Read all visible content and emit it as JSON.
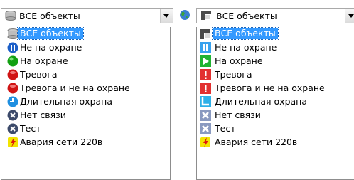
{
  "left_combo": {
    "value": "ВСЕ объекты",
    "icon": "database-icon"
  },
  "right_combo": {
    "value": "ВСЕ объекты",
    "icon": "folder-dark-icon"
  },
  "globe_icon": "globe-icon",
  "left_list": [
    {
      "label": "ВСЕ объекты",
      "icon": "database-icon",
      "selected": true
    },
    {
      "label": "Не на охране",
      "icon": "pause-circle-blue-icon"
    },
    {
      "label": "На охране",
      "icon": "circle-green-icon"
    },
    {
      "label": "Тревога",
      "icon": "circle-red-icon"
    },
    {
      "label": "Тревога и не на охране",
      "icon": "circle-red-icon"
    },
    {
      "label": "Длительная охрана",
      "icon": "clock-blue-icon"
    },
    {
      "label": "Нет связи",
      "icon": "x-circle-gray-icon"
    },
    {
      "label": "Тест",
      "icon": "x-circle-gray-icon"
    },
    {
      "label": "Авария сети 220в",
      "icon": "lightning-icon"
    }
  ],
  "right_list": [
    {
      "label": "ВСЕ объекты",
      "icon": "folder-dark-icon",
      "selected": true
    },
    {
      "label": "Не на охране",
      "icon": "pause-square-blue-icon"
    },
    {
      "label": "На охране",
      "icon": "play-square-green-icon"
    },
    {
      "label": "Тревога",
      "icon": "alert-square-red-icon"
    },
    {
      "label": "Тревога и не на охране",
      "icon": "alert-square-red-icon"
    },
    {
      "label": "Длительная охрана",
      "icon": "clock-square-blue-icon"
    },
    {
      "label": "Нет связи",
      "icon": "x-square-gray-icon"
    },
    {
      "label": "Тест",
      "icon": "x-square-gray-icon"
    },
    {
      "label": "Авария сети 220в",
      "icon": "lightning-icon"
    }
  ]
}
